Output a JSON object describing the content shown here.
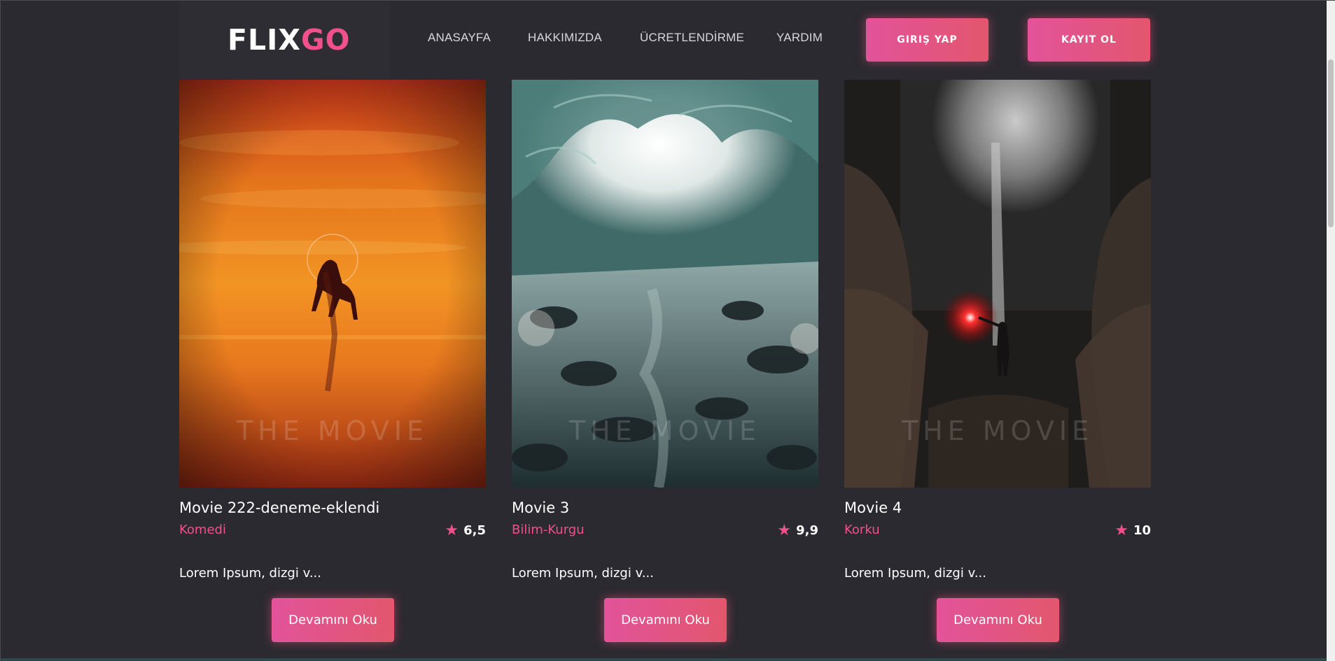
{
  "brand": {
    "logo_part1": "FLIX",
    "logo_part2": "GO",
    "accent": "#f1508a"
  },
  "nav": {
    "items": [
      {
        "label": "ANASAYFA"
      },
      {
        "label": "HAKKIMIZDA"
      },
      {
        "label": "ÜCRETLENDİRME"
      },
      {
        "label": "YARDIM"
      }
    ],
    "login_label": "GIRIŞ YAP",
    "signup_label": "KAYIT OL"
  },
  "movies": [
    {
      "title": "Movie 222-deneme-eklendi",
      "genre": "Komedi",
      "rating": "6,5",
      "description": "Lorem Ipsum, dizgi v...",
      "poster_text": "THE MOVIE",
      "read_more": "Devamını Oku"
    },
    {
      "title": "Movie 3",
      "genre": "Bilim-Kurgu",
      "rating": "9,9",
      "description": "Lorem Ipsum, dizgi v...",
      "poster_text": "THE MOVIE",
      "read_more": "Devamını Oku"
    },
    {
      "title": "Movie 4",
      "genre": "Korku",
      "rating": "10",
      "description": "Lorem Ipsum, dizgi v...",
      "poster_text": "THE MOVIE",
      "read_more": "Devamını Oku"
    }
  ],
  "icons": {
    "rating": "star-icon"
  }
}
